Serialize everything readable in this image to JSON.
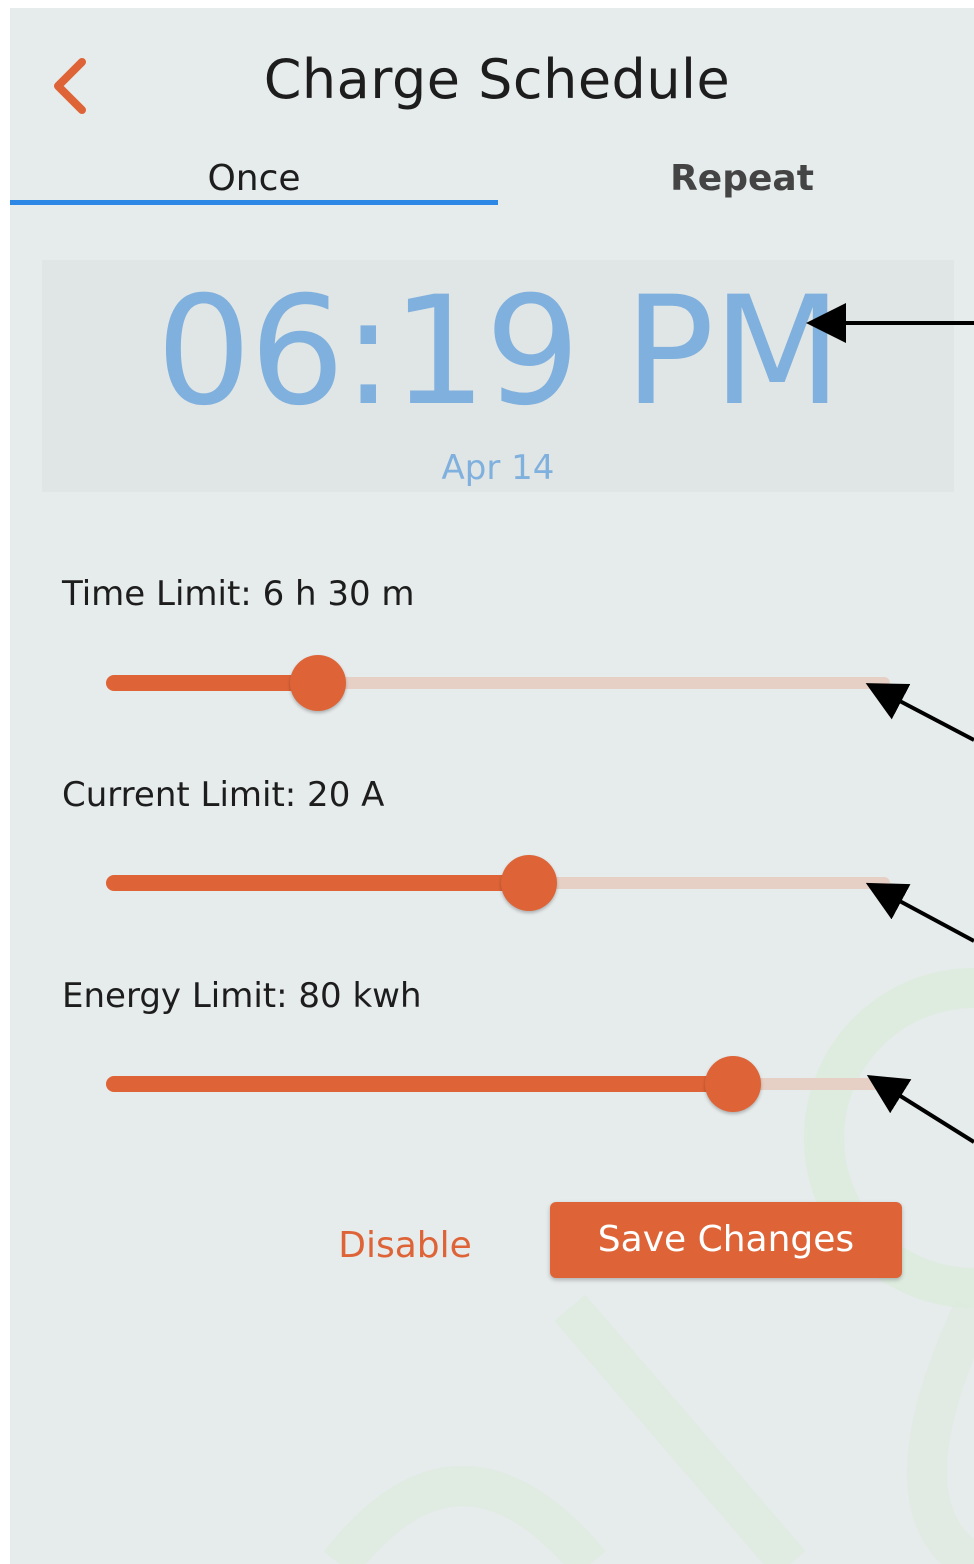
{
  "header": {
    "title": "Charge Schedule",
    "back_icon": "chevron-left-icon"
  },
  "tabs": [
    {
      "label": "Once",
      "active": true
    },
    {
      "label": "Repeat",
      "active": false
    }
  ],
  "schedule": {
    "time": "06:19 PM",
    "date": "Apr 14"
  },
  "sliders": [
    {
      "label": "Time Limit: 6 h 30 m",
      "fraction": 0.27
    },
    {
      "label": "Current Limit: 20 A",
      "fraction": 0.54
    },
    {
      "label": "Energy Limit: 80 kwh",
      "fraction": 0.8
    }
  ],
  "actions": {
    "disable_label": "Disable",
    "save_label": "Save Changes"
  },
  "colors": {
    "accent": "#de6438",
    "tab_indicator": "#2c88e4",
    "time_text": "#7fb0de",
    "background": "#e6ebeb"
  }
}
